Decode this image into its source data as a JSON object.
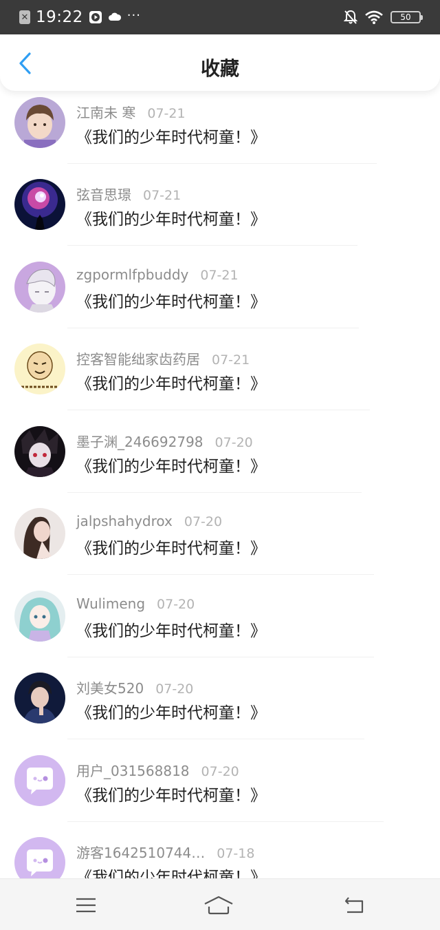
{
  "status_bar": {
    "time": "19:22",
    "more": "···",
    "battery": "50",
    "icons": [
      "close-box-icon",
      "media-play-icon",
      "cloud-icon",
      "bell-off-icon",
      "wifi-icon",
      "battery-icon"
    ]
  },
  "header": {
    "title": "收藏",
    "back_icon": "chevron-left-icon",
    "accent_color": "#2f9ef3"
  },
  "list": {
    "items": [
      {
        "user": "江南未 寒",
        "date": "07-21",
        "title": "《我们的少年时代柯童！》",
        "avatar": "photo-young-man"
      },
      {
        "user": "弦音思璟",
        "date": "07-21",
        "title": "《我们的少年时代柯童！》",
        "avatar": "galaxy-image"
      },
      {
        "user": "zgpormlfpbuddy",
        "date": "07-21",
        "title": "《我们的少年时代柯童！》",
        "avatar": "anime-sketch"
      },
      {
        "user": "控客智能绌家齿药居",
        "date": "07-21",
        "title": "《我们的少年时代柯童！》",
        "avatar": "meme-face"
      },
      {
        "user": "墨子渊_246692798",
        "date": "07-20",
        "title": "《我们的少年时代柯童！》",
        "avatar": "dark-anime"
      },
      {
        "user": "jalpshahydrox",
        "date": "07-20",
        "title": "《我们的少年时代柯童！》",
        "avatar": "photo-woman"
      },
      {
        "user": "Wulimeng",
        "date": "07-20",
        "title": "《我们的少年时代柯童！》",
        "avatar": "anime-miku"
      },
      {
        "user": "刘美女520",
        "date": "07-20",
        "title": "《我们的少年时代柯童！》",
        "avatar": "photo-singer"
      },
      {
        "user": "用户_031568818",
        "date": "07-20",
        "title": "《我们的少年时代柯童！》",
        "avatar": "default-chat-bubble"
      },
      {
        "user": "游客1642510744…",
        "date": "07-18",
        "title": "《我们的少年时代柯童！》",
        "avatar": "default-chat-bubble"
      }
    ]
  },
  "bottom_nav": {
    "icons": [
      "menu-icon",
      "home-icon",
      "back-icon"
    ]
  }
}
